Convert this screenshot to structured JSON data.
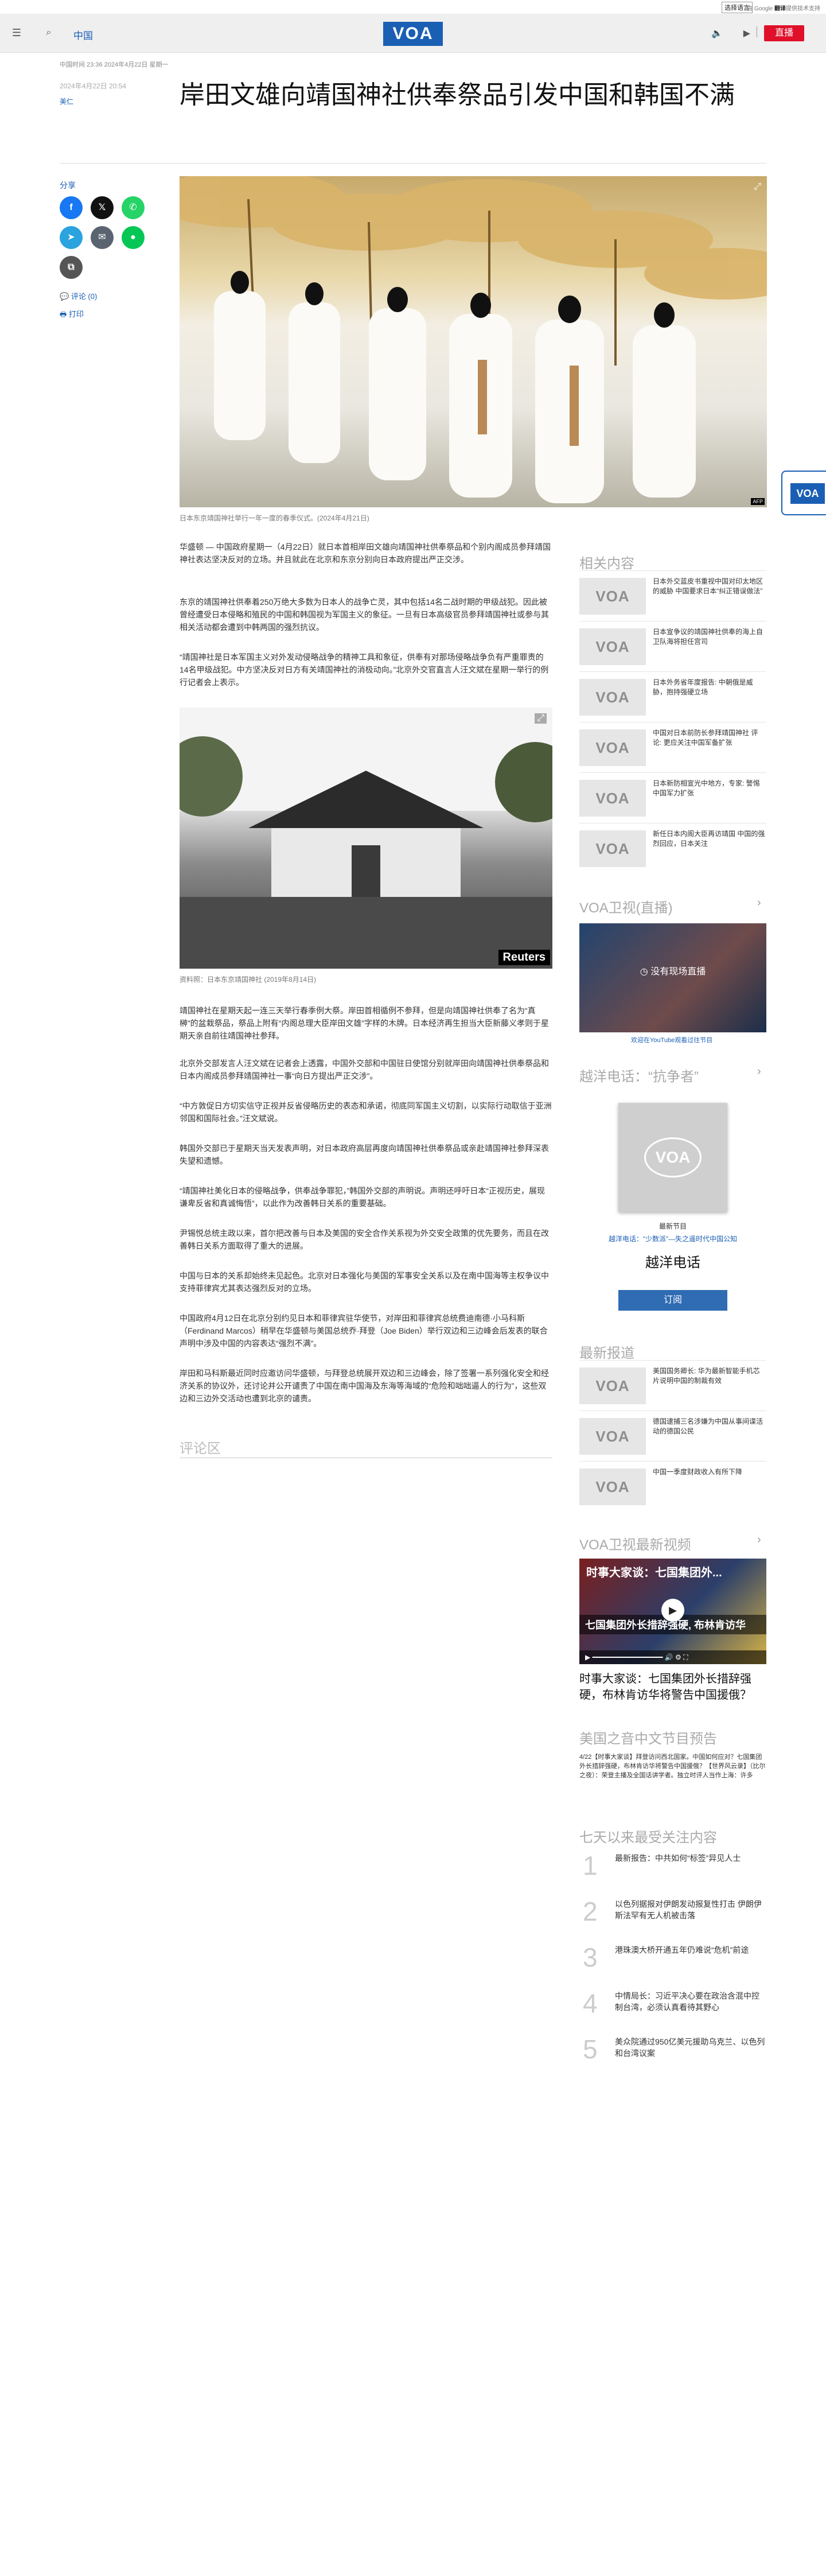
{
  "topbar": {
    "language_select": "选择语言",
    "translate_prefix": "由 Google",
    "translate_brand": "翻译",
    "translate_suffix": "提供技术支持"
  },
  "header": {
    "section": "中国",
    "logo": "VOA",
    "live_label": "直播",
    "menu_icon": "menu-icon",
    "search_icon": "search-icon",
    "audio_icon": "audio-icon",
    "video_icon": "video-icon"
  },
  "article": {
    "meta_line": "中国时间 23:36 2024年4月22日 星期一",
    "date": "2024年4月22日 20:54",
    "author": "美仁",
    "title": "岸田文雄向靖国神社供奉祭品引发中国和韩国不满",
    "share_label": "分享",
    "comments_link": "评论 (0)",
    "print_link": "打印",
    "hero_caption": "日本东京靖国神社举行一年一度的春季仪式。(2024年4月21日)",
    "image2_caption": "资料照：日本东京靖国神社 (2019年8月14日)",
    "paragraphs1": [
      "华盛顿 — 中国政府星期一（4月22日）就日本首相岸田文雄向靖国神社供奉祭品和个别内阁成员参拜靖国神社表达坚决反对的立场。并且就此在北京和东京分别向日本政府提出严正交涉。",
      "东京的靖国神社供奉着250万绝大多数为日本人的战争亡灵，其中包括14名二战时期的甲级战犯。因此被曾经遭受日本侵略和殖民的中国和韩国视为军国主义的象征。一旦有日本高级官员参拜靖国神社或参与其相关活动都会遭到中韩两国的强烈抗议。",
      "“靖国神社是日本军国主义对外发动侵略战争的精神工具和象征，供奉有对那场侵略战争负有严重罪责的14名甲级战犯。中方坚决反对日方有关靖国神社的消极动向。”北京外交官直言人汪文斌在星期一举行的例行记者会上表示。"
    ],
    "paragraphs2": [
      "靖国神社在星期天起一连三天举行春季例大祭。岸田首相循例不参拜，但是向靖国神社供奉了名为“真榊”的盆栽祭品，祭品上附有“内阁总理大臣岸田文雄”字样的木牌。日本经济再生担当大臣新藤义孝则于星期天亲自前往靖国神社参拜。",
      "北京外交部发言人汪文斌在记者会上透露，中国外交部和中国驻日使馆分别就岸田向靖国神社供奉祭品和日本内阁成员参拜靖国神社一事“向日方提出严正交涉”。",
      "“中方敦促日方切实信守正视并反省侵略历史的表态和承诺，彻底同军国主义切割，以实际行动取信于亚洲邻国和国际社会。”汪文斌说。",
      "韩国外交部已于星期天当天发表声明，对日本政府高层再度向靖国神社供奉祭品或亲赴靖国神社参拜深表失望和遗憾。",
      "“靖国神社美化日本的侵略战争，供奉战争罪犯，”韩国外交部的声明说。声明还呼吁日本“正视历史，展现谦卑反省和真诚悔悟”，以此作为改善韩日关系的重要基础。",
      "尹锡悦总统主政以来，首尔把改善与日本及美国的安全合作关系视为外交安全政策的优先要务，而且在改善韩日关系方面取得了重大的进展。",
      "中国与日本的关系却始终未见起色。北京对日本强化与美国的军事安全关系以及在南中国海等主权争议中支持菲律宾尤其表达强烈反对的立场。",
      "中国政府4月12日在北京分别约见日本和菲律宾驻华使节，对岸田和菲律宾总统费迪南德·小马科斯（Ferdinand Marcos）稍早在华盛顿与美国总统乔·拜登（Joe Biden）举行双边和三边峰会后发表的联合声明中涉及中国的内容表达“强烈不满”。",
      "岸田和马科斯最近同时应邀访问华盛顿，与拜登总统展开双边和三边峰会，除了签署一系列强化安全和经济关系的协议外，还讨论并公开谴责了中国在南中国海及东海等海域的“危险和咄咄逼人的行为”，这些双边和三边外交活动也遭到北京的谴责。"
    ],
    "comments_heading": "评论区"
  },
  "sidebar": {
    "related_heading": "相关内容",
    "related": [
      {
        "text": "日本外交蓝皮书重视中国对印太地区的威胁 中国要求日本“纠正错误做法”"
      },
      {
        "text": "日本宣争议的靖国神社供奉的海上自卫队海将担任宫司"
      },
      {
        "text": "日本外务省年度报告: 中朝俄是威胁，抱持强硬立场"
      },
      {
        "text": "中国对日本前防长参拜靖国神社 评论: 更应关注中国军备扩张"
      },
      {
        "text": "日本新防相宣光中地方，专家: 警惕中国军力扩张"
      },
      {
        "text": "新任日本内阁大臣再访靖国 中国的强烈回应，日本关注"
      }
    ],
    "tv_heading": "VOA卫视(直播)",
    "tv_overlay": "没有现场直播",
    "tv_link": "欢迎在YouTube观看过往节目",
    "hotline_heading": "越洋电话：“抗争者”",
    "hotline_label": "最新节目",
    "hotline_sub": "越洋电话：“少数派”—失之遥时代中国公知",
    "hotline_title": "越洋电话",
    "subscribe": "订阅",
    "latest_heading": "最新报道",
    "latest": [
      {
        "text": "美国国务卿长: 华为最新智能手机芯片说明中国的制裁有效"
      },
      {
        "text": "德国逮捕三名涉嫌为中国从事间谍活动的德国公民"
      },
      {
        "text": "中国一季度财政收入有所下降"
      }
    ],
    "video_heading": "VOA卫视最新视频",
    "video_banner": "时事大家谈：七国集团外...",
    "video_caption": "七国集团外长措辞强硬, 布林肯访华",
    "video_title": "时事大家谈：七国集团外长措辞强硬，布林肯访华将警告中国援俄？",
    "preview_heading": "美国之音中文节目预告",
    "preview_text": "4/22【时事大家谈】拜登访问西北国家。中国如何应对？七国集团外长措辞强硬，布林肯访华将警告中国援俄？【世界风云录】（比尔之夜）：荣登主播及全国话讲学者。独立时评人当作上海：许多",
    "mostread_heading": "七天以来最受关注内容",
    "mostread": [
      {
        "num": "1",
        "text": "最新报告：中共如何“标签”异见人士"
      },
      {
        "num": "2",
        "text": "以色列据报对伊朗发动报复性打击 伊朗伊斯法罕有无人机被击落"
      },
      {
        "num": "3",
        "text": "港珠澳大桥开通五年仍难说“危机”前途"
      },
      {
        "num": "4",
        "text": "中情局长：习近平决心要在政治含混中控制台湾，必须认真看待其野心"
      },
      {
        "num": "5",
        "text": "美众院通过950亿美元援助乌克兰、以色列和台湾议案"
      }
    ]
  },
  "colors": {
    "brand": "#1a5fb4",
    "live": "#e0102a"
  }
}
